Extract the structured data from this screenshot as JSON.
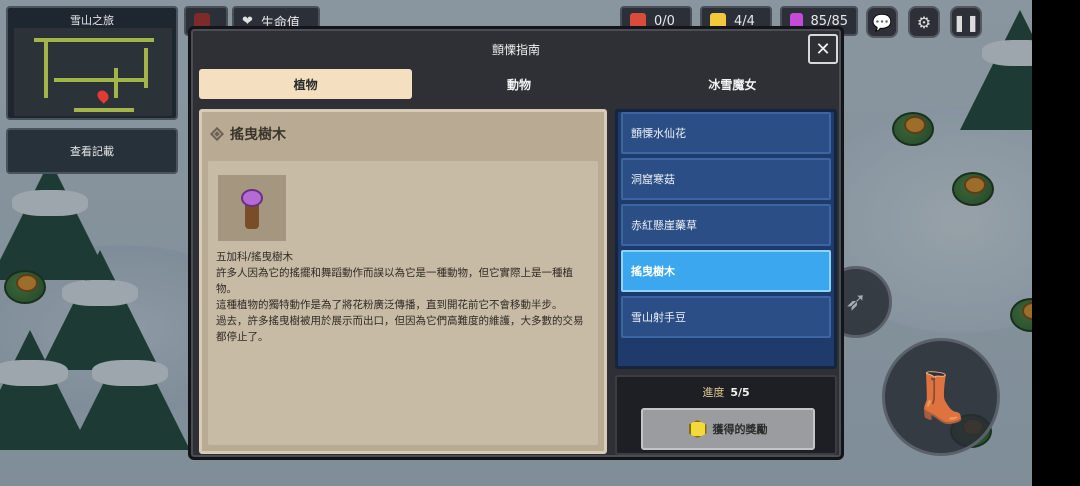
{
  "hud": {
    "minimap_title": "雪山之旅",
    "record_button": "查看記載",
    "health_label": "生命值",
    "stat_a": "0/0",
    "stat_b": "4/4",
    "stat_c": "85/85"
  },
  "dialog": {
    "title": "顫慄指南",
    "close_label": "✕",
    "tabs": [
      {
        "label": "植物"
      },
      {
        "label": "動物"
      },
      {
        "label": "冰雪魔女"
      }
    ],
    "detail": {
      "name": "搖曳樹木",
      "lines": [
        "五加科/搖曳樹木",
        "許多人因為它的搖擺和舞蹈動作而誤以為它是一種動物，但它實際上是一種植物。",
        "這種植物的獨特動作是為了將花粉廣泛傳播，直到開花前它不會移動半步。",
        "過去，許多搖曳樹被用於展示而出口，但因為它們高難度的維護，大多數的交易都停止了。"
      ]
    },
    "list": [
      {
        "label": "顫慄水仙花"
      },
      {
        "label": "洞窟寒菇"
      },
      {
        "label": "赤紅懸崖藥草"
      },
      {
        "label": "搖曳樹木"
      },
      {
        "label": "雪山射手豆"
      }
    ],
    "progress": {
      "label": "進度",
      "value": "5/5"
    },
    "reward_button": "獲得的獎勵"
  }
}
